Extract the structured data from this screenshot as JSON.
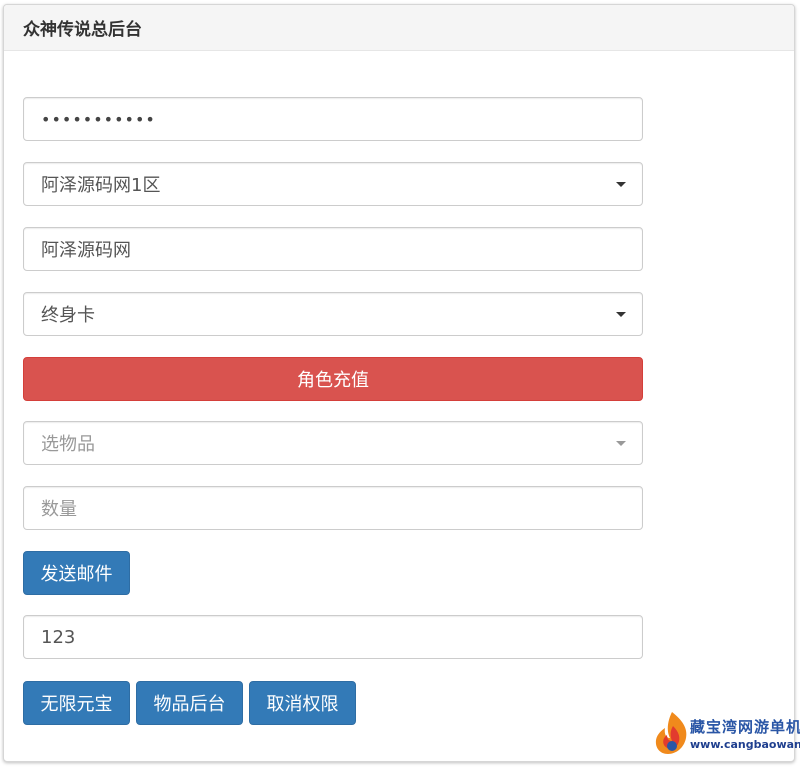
{
  "header": {
    "title": "众神传说总后台"
  },
  "form": {
    "password": {
      "value": "•••••••••••"
    },
    "server_select": {
      "value": "阿泽源码网1区"
    },
    "role_input": {
      "value": "阿泽源码网"
    },
    "card_select": {
      "value": "终身卡"
    },
    "recharge_button": {
      "label": "角色充值"
    },
    "item_select": {
      "placeholder": "选物品"
    },
    "quantity_input": {
      "placeholder": "数量"
    },
    "send_mail_button": {
      "label": "发送邮件"
    },
    "code_input": {
      "value": "123"
    },
    "unlimited_gold_button": {
      "label": "无限元宝"
    },
    "item_admin_button": {
      "label": "物品后台"
    },
    "revoke_button": {
      "label": "取消权限"
    }
  },
  "watermark": {
    "name": "藏宝湾网游单机",
    "url": "www.cangbaowan.net"
  },
  "colors": {
    "danger": "#d9534f",
    "primary": "#337ab7",
    "heading_bg": "#f5f5f5"
  }
}
